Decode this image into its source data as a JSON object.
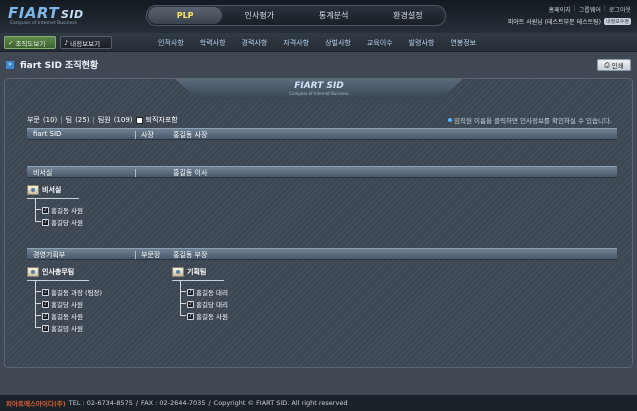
{
  "header": {
    "logo_main": "FIART",
    "logo_sid": "SID",
    "logo_sub": "Compass of Internet Business",
    "tabs": [
      "PLP",
      "인사평가",
      "통계분석",
      "환경설정"
    ],
    "links": [
      "홈페이지",
      "그룹웨어",
      "로그아웃"
    ],
    "user": "피아트 사원님 (테스트부문 테스트팀)",
    "badge": "내정보수정"
  },
  "subnav": {
    "org_button": "조직도보기",
    "my_button": "내정보보기",
    "items": [
      "인적사항",
      "학력사항",
      "경력사항",
      "자격사항",
      "상벌사항",
      "교육이수",
      "발령사항",
      "연봉정보"
    ]
  },
  "page": {
    "title": "fiart SID 조직현황",
    "print_label": "인쇄"
  },
  "panel": {
    "logo_text": "FIART SID",
    "logo_sub": "Compass of Internet Business",
    "counts": {
      "dept_label": "부문",
      "dept_count": "(10)",
      "team_label": "팀",
      "team_count": "(25)",
      "staff_label": "팀원",
      "staff_count": "(109)",
      "retired_label": "퇴직자포함"
    },
    "hint": "임직원 이름을 클릭하면 인사정보를 확인하실 수 있습니다."
  },
  "sections": [
    {
      "name": "fiart SID",
      "role": "사장",
      "person": "홍길동 사장",
      "groups": []
    },
    {
      "name": "비서실",
      "role": "",
      "person": "홍길동 이사",
      "groups": [
        {
          "name": "비서실",
          "members": [
            "홍길동 사원",
            "홍길당 사원"
          ]
        }
      ]
    },
    {
      "name": "경영기획부",
      "role": "부문장",
      "person": "홍길동 부장",
      "groups": [
        {
          "name": "인사총무팀",
          "members": [
            "홍길동 과장 (팀장)",
            "홍길당 사원",
            "홍길동 사원",
            "홍길덩 사원"
          ]
        },
        {
          "name": "기획팀",
          "members": [
            "홍길동 대리",
            "홍길당 대리",
            "홍길동 사원"
          ]
        }
      ]
    }
  ],
  "footer": {
    "brand": "피아트에스아이디(주)",
    "tel": "TEL : 02-6734-8575",
    "fax": "FAX : 02-2644-7035",
    "copyright": "Copyright © FIART SID. All right reserved"
  }
}
